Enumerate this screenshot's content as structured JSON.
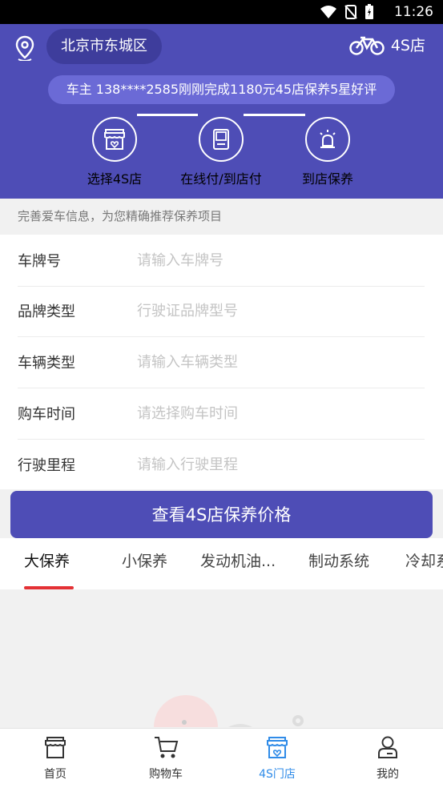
{
  "status_bar": {
    "time": "11:26"
  },
  "header": {
    "city": "北京市东城区",
    "shop_label": "4S店",
    "notice": "车主 138****2585刚刚完成1180元45店保养5星好评"
  },
  "steps": [
    {
      "label": "选择4S店",
      "icon": "store-icon"
    },
    {
      "label": "在线付/到店付",
      "icon": "pos-terminal-icon"
    },
    {
      "label": "到店保养",
      "icon": "alarm-light-icon"
    }
  ],
  "tip": "完善爱车信息，为您精确推荐保养项目",
  "form": {
    "fields": [
      {
        "label": "车牌号",
        "placeholder": "请输入车牌号"
      },
      {
        "label": "品牌类型",
        "placeholder": "行驶证品牌型号"
      },
      {
        "label": "车辆类型",
        "placeholder": "请输入车辆类型"
      },
      {
        "label": "购车时间",
        "placeholder": "请选择购车时间"
      },
      {
        "label": "行驶里程",
        "placeholder": "请输入行驶里程"
      }
    ]
  },
  "cta_label": "查看4S店保养价格",
  "tabs": [
    {
      "label": "大保养",
      "active": true
    },
    {
      "label": "小保养"
    },
    {
      "label": "发动机油..."
    },
    {
      "label": "制动系统"
    },
    {
      "label": "冷却系统"
    }
  ],
  "bottom_nav": [
    {
      "label": "首页",
      "icon": "home-store-icon"
    },
    {
      "label": "购物车",
      "icon": "cart-icon"
    },
    {
      "label": "4S门店",
      "icon": "store-heart-icon",
      "active": true
    },
    {
      "label": "我的",
      "icon": "user-icon"
    }
  ],
  "colors": {
    "primary": "#4e4db6",
    "accent": "#e43135",
    "nav_active": "#2f8be8"
  }
}
